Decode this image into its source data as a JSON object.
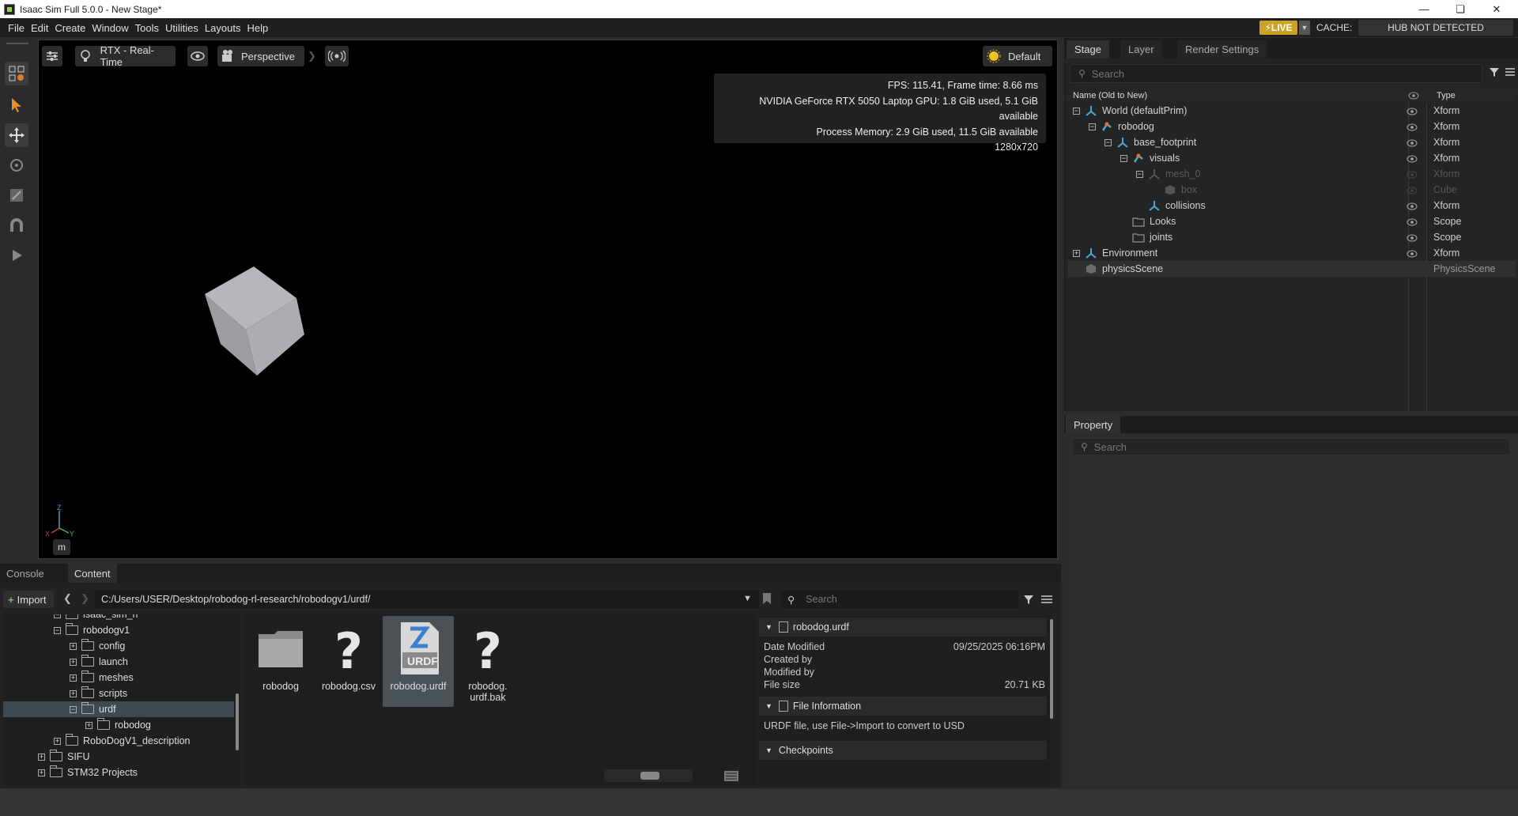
{
  "window": {
    "title": "Isaac Sim Full 5.0.0 - New Stage*",
    "minimize_icon": "minimize-icon",
    "restore_icon": "restore-icon",
    "close_icon": "close-icon"
  },
  "menu": [
    "File",
    "Edit",
    "Create",
    "Window",
    "Tools",
    "Utilities",
    "Layouts",
    "Help"
  ],
  "status_right": {
    "live": "LIVE",
    "cache_label": "CACHE:",
    "hub": "HUB NOT DETECTED"
  },
  "viewport": {
    "toolbar": {
      "renderer": "RTX - Real-Time",
      "camera": "Perspective",
      "lighting": "Default"
    },
    "stats": {
      "fps": "FPS: 115.41, Frame time: 8.66 ms",
      "gpu": "NVIDIA GeForce RTX 5050 Laptop GPU: 1.8 GiB used, 5.1 GiB available",
      "memory": "Process Memory: 2.9 GiB used, 11.5 GiB available",
      "resolution": "1280x720"
    },
    "axis": {
      "z": "Z",
      "x": "X",
      "y": "Y"
    },
    "units": "m"
  },
  "stage": {
    "tabs": [
      "Stage",
      "Layer",
      "Render Settings"
    ],
    "search_placeholder": "Search",
    "col_name": "Name (Old to New)",
    "col_type": "Type",
    "rows": [
      {
        "name": "World (defaultPrim)",
        "type": "Xform"
      },
      {
        "name": "robodog",
        "type": "Xform"
      },
      {
        "name": "base_footprint",
        "type": "Xform"
      },
      {
        "name": "visuals",
        "type": "Xform"
      },
      {
        "name": "mesh_0",
        "type": "Xform"
      },
      {
        "name": "box",
        "type": "Cube"
      },
      {
        "name": "collisions",
        "type": "Xform"
      },
      {
        "name": "Looks",
        "type": "Scope"
      },
      {
        "name": "joints",
        "type": "Scope"
      },
      {
        "name": "Environment",
        "type": "Xform"
      },
      {
        "name": "physicsScene",
        "type": "PhysicsScene"
      }
    ]
  },
  "property": {
    "tab": "Property",
    "search_placeholder": "Search"
  },
  "bottom": {
    "tabs": [
      "Console",
      "Content"
    ],
    "import_label": "Import",
    "path": "C:/Users/USER/Desktop/robodog-rl-research/robodogv1/urdf/",
    "search_placeholder": "Search",
    "tree": [
      {
        "label": "isaac_sim_rl"
      },
      {
        "label": "robodogv1"
      },
      {
        "label": "config"
      },
      {
        "label": "launch"
      },
      {
        "label": "meshes"
      },
      {
        "label": "scripts"
      },
      {
        "label": "urdf"
      },
      {
        "label": "robodog"
      },
      {
        "label": "RoboDogV1_description"
      },
      {
        "label": "SIFU"
      },
      {
        "label": "STM32 Projects"
      }
    ],
    "files": [
      {
        "name": "robodog",
        "icon": "folder-icon"
      },
      {
        "name": "robodog.csv",
        "icon": "unknown-file-icon"
      },
      {
        "name": "robodog.urdf",
        "icon": "urdf-file-icon"
      },
      {
        "name": "robodog.\nurdf.bak",
        "icon": "unknown-file-icon"
      }
    ],
    "details": {
      "filename": "robodog.urdf",
      "date_modified_label": "Date Modified",
      "date_modified": "09/25/2025 06:16PM",
      "created_by_label": "Created by",
      "modified_by_label": "Modified by",
      "file_size_label": "File size",
      "file_size": "20.71 KB",
      "file_info_header": "File Information",
      "file_info_text": "URDF file, use File->Import to convert to USD",
      "checkpoints_header": "Checkpoints"
    }
  },
  "colors": {
    "live": "#c9a227",
    "xform_icon": "#4aa8d8",
    "selected": "#3d4a52"
  }
}
